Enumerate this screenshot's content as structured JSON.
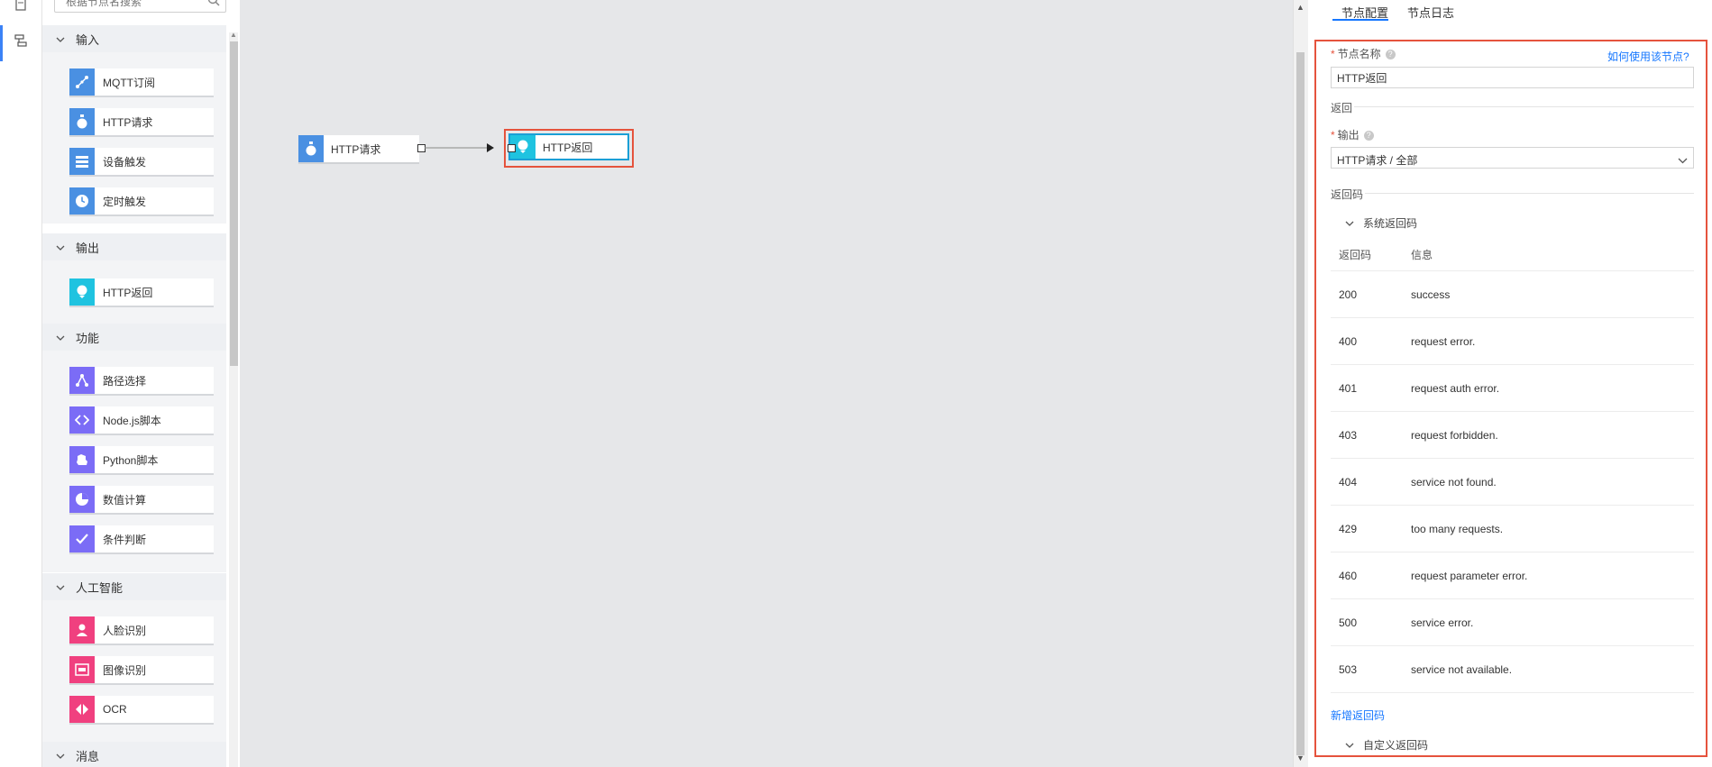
{
  "rail": {
    "icons": [
      "list-icon",
      "flow-icon"
    ]
  },
  "palette": {
    "search_placeholder": "根据节点名搜索",
    "groups": [
      {
        "label": "输入",
        "items": [
          {
            "label": "MQTT订阅",
            "icon": "mqtt-icon",
            "color": "#4a90e2"
          },
          {
            "label": "HTTP请求",
            "icon": "http-request-icon",
            "color": "#4a90e2"
          },
          {
            "label": "设备触发",
            "icon": "device-trigger-icon",
            "color": "#4a90e2"
          },
          {
            "label": "定时触发",
            "icon": "clock-icon",
            "color": "#4a90e2"
          }
        ]
      },
      {
        "label": "输出",
        "items": [
          {
            "label": "HTTP返回",
            "icon": "http-response-icon",
            "color": "#1fc3e0"
          }
        ]
      },
      {
        "label": "功能",
        "items": [
          {
            "label": "路径选择",
            "icon": "path-select-icon",
            "color": "#7b6cf6"
          },
          {
            "label": "Node.js脚本",
            "icon": "code-icon",
            "color": "#7b6cf6"
          },
          {
            "label": "Python脚本",
            "icon": "python-icon",
            "color": "#7b6cf6"
          },
          {
            "label": "数值计算",
            "icon": "pie-icon",
            "color": "#7b6cf6"
          },
          {
            "label": "条件判断",
            "icon": "check-icon",
            "color": "#7b6cf6"
          }
        ]
      },
      {
        "label": "人工智能",
        "items": [
          {
            "label": "人脸识别",
            "icon": "face-icon",
            "color": "#f0407f"
          },
          {
            "label": "图像识别",
            "icon": "image-recognition-icon",
            "color": "#f0407f"
          },
          {
            "label": "OCR",
            "icon": "ocr-icon",
            "color": "#f0407f"
          }
        ]
      },
      {
        "label": "消息",
        "items": []
      }
    ]
  },
  "canvas": {
    "nodes": [
      {
        "label": "HTTP请求",
        "icon": "http-request-icon",
        "color": "#4a90e2"
      },
      {
        "label": "HTTP返回",
        "icon": "http-response-icon",
        "color": "#1fc3e0"
      }
    ]
  },
  "panel": {
    "tabs": [
      "节点配置",
      "节点日志"
    ],
    "active_tab": "节点配置",
    "node_name_label": "节点名称",
    "help_link": "如何使用该节点?",
    "node_name_value": "HTTP返回",
    "return_section": "返回",
    "output_label": "输出",
    "output_value": "HTTP请求 / 全部",
    "return_code_section": "返回码",
    "system_codes_label": "系统返回码",
    "table_headers": [
      "返回码",
      "信息"
    ],
    "rows": [
      {
        "code": "200",
        "message": "success"
      },
      {
        "code": "400",
        "message": "request error."
      },
      {
        "code": "401",
        "message": "request auth error."
      },
      {
        "code": "403",
        "message": "request forbidden."
      },
      {
        "code": "404",
        "message": "service not found."
      },
      {
        "code": "429",
        "message": "too many requests."
      },
      {
        "code": "460",
        "message": "request parameter error."
      },
      {
        "code": "500",
        "message": "service error."
      },
      {
        "code": "503",
        "message": "service not available."
      }
    ],
    "add_code_link": "新增返回码",
    "custom_codes_label": "自定义返回码"
  },
  "colors": {
    "accent": "#1677ff",
    "highlight_border": "#e5533d",
    "canvas_bg": "#e6e7e9"
  }
}
